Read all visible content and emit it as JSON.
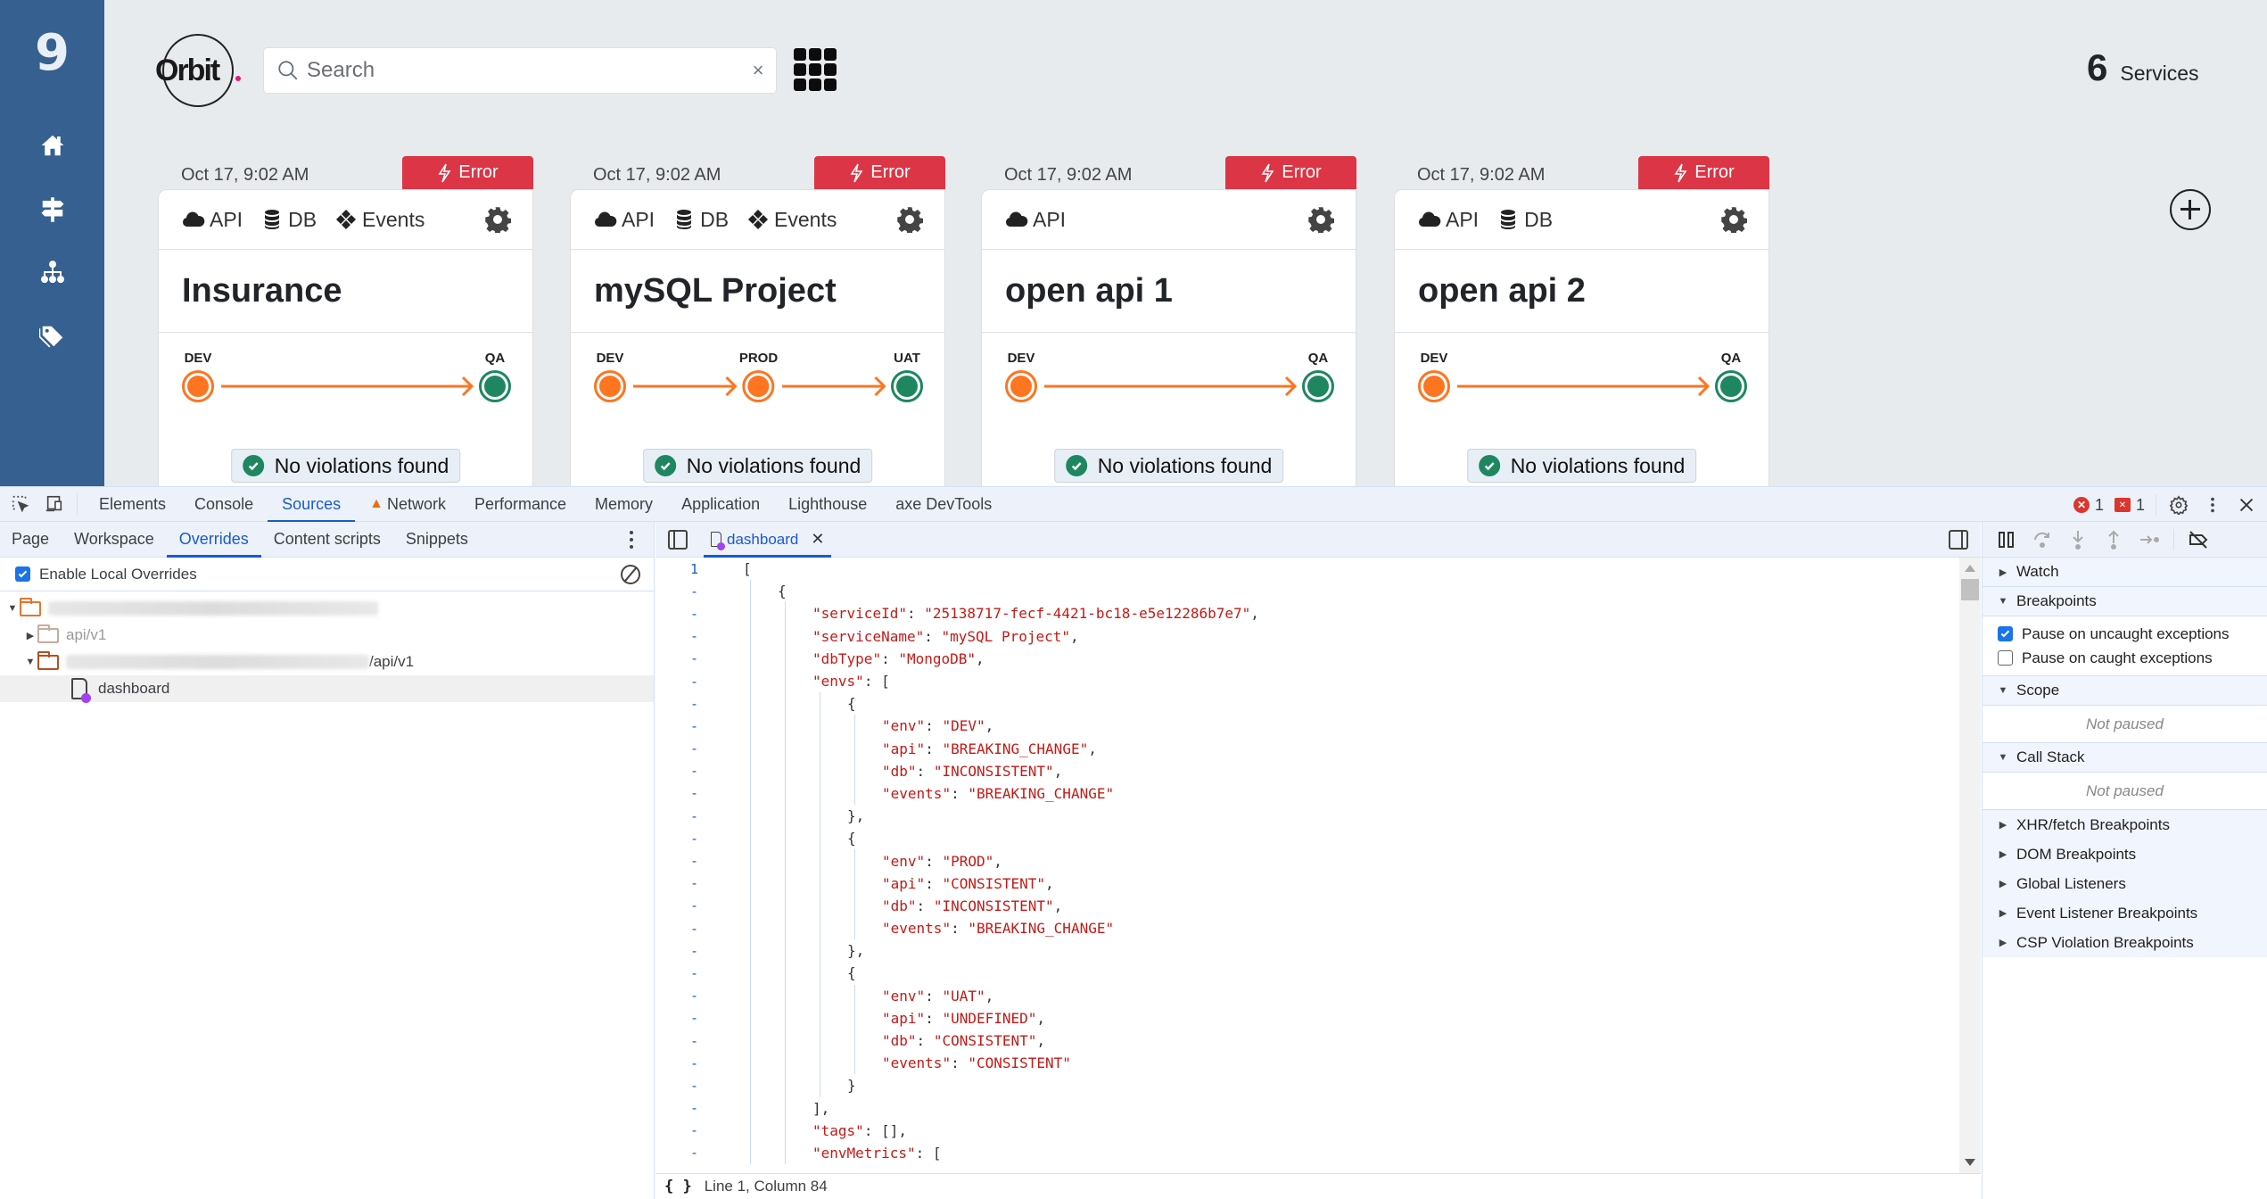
{
  "app": {
    "sidebar": {
      "logo": "9",
      "items": [
        {
          "name": "home",
          "icon": "home-icon"
        },
        {
          "name": "signpost",
          "icon": "signpost-icon"
        },
        {
          "name": "sitemap",
          "icon": "sitemap-icon"
        },
        {
          "name": "tags",
          "icon": "tags-icon"
        }
      ]
    },
    "brand": "Orbit",
    "search": {
      "placeholder": "Search",
      "value": "",
      "clear_label": "×"
    },
    "services_count": {
      "number": "6",
      "label": "Services"
    },
    "colors": {
      "sidebar": "#35608f",
      "error": "#dc3545",
      "env_warning": "#fd7521",
      "env_ok": "#1e8760",
      "badge_bg": "#e7eef6"
    },
    "cards": [
      {
        "date": "Oct 17, 9:02 AM",
        "status": "Error",
        "features": [
          {
            "label": "API",
            "icon": "cloud-icon"
          },
          {
            "label": "DB",
            "icon": "database-icon"
          },
          {
            "label": "Events",
            "icon": "events-icon"
          }
        ],
        "title": "Insurance",
        "envs": [
          {
            "name": "DEV",
            "state": "orange"
          },
          {
            "name": "QA",
            "state": "green"
          }
        ],
        "violations": "No violations found"
      },
      {
        "date": "Oct 17, 9:02 AM",
        "status": "Error",
        "features": [
          {
            "label": "API",
            "icon": "cloud-icon"
          },
          {
            "label": "DB",
            "icon": "database-icon"
          },
          {
            "label": "Events",
            "icon": "events-icon"
          }
        ],
        "title": "mySQL Project",
        "envs": [
          {
            "name": "DEV",
            "state": "orange"
          },
          {
            "name": "PROD",
            "state": "orange"
          },
          {
            "name": "UAT",
            "state": "green"
          }
        ],
        "violations": "No violations found"
      },
      {
        "date": "Oct 17, 9:02 AM",
        "status": "Error",
        "features": [
          {
            "label": "API",
            "icon": "cloud-icon"
          }
        ],
        "title": "open api 1",
        "envs": [
          {
            "name": "DEV",
            "state": "orange"
          },
          {
            "name": "QA",
            "state": "green"
          }
        ],
        "violations": "No violations found"
      },
      {
        "date": "Oct 17, 9:02 AM",
        "status": "Error",
        "features": [
          {
            "label": "API",
            "icon": "cloud-icon"
          },
          {
            "label": "DB",
            "icon": "database-icon"
          }
        ],
        "title": "open api 2",
        "envs": [
          {
            "name": "DEV",
            "state": "orange"
          },
          {
            "name": "QA",
            "state": "green"
          }
        ],
        "violations": "No violations found"
      }
    ]
  },
  "devtools": {
    "tabs": [
      {
        "label": "Elements"
      },
      {
        "label": "Console"
      },
      {
        "label": "Sources",
        "active": true
      },
      {
        "label": "Network",
        "warning": true
      },
      {
        "label": "Performance"
      },
      {
        "label": "Memory"
      },
      {
        "label": "Application"
      },
      {
        "label": "Lighthouse"
      },
      {
        "label": "axe DevTools"
      }
    ],
    "error_count": "1",
    "issue_count": "1",
    "navigator": {
      "tabs": [
        {
          "label": "Page"
        },
        {
          "label": "Workspace"
        },
        {
          "label": "Overrides",
          "active": true
        },
        {
          "label": "Content scripts"
        },
        {
          "label": "Snippets"
        }
      ],
      "enable_overrides_label": "Enable Local Overrides",
      "enable_overrides_checked": true,
      "tree": [
        {
          "level": 0,
          "expanded": true,
          "type": "folder",
          "label": "",
          "blurred": true,
          "color": "#e8742e"
        },
        {
          "level": 1,
          "expanded": false,
          "type": "folder",
          "label": "api/v1",
          "blurred": false,
          "color": "#c5aca0",
          "muted": true
        },
        {
          "level": 1,
          "expanded": true,
          "type": "folder",
          "label": "/api/v1",
          "blurred": true,
          "color": "#b8501f"
        },
        {
          "level": 2,
          "type": "file",
          "label": "dashboard",
          "selected": true
        }
      ]
    },
    "editor": {
      "open_file": "dashboard",
      "first_line_number": "1",
      "other_line_marker": "-",
      "lines": [
        {
          "indent": 0,
          "text": "["
        },
        {
          "indent": 1,
          "text": "{"
        },
        {
          "indent": 2,
          "key": "serviceId",
          "value": "\"25138717-fecf-4421-bc18-e5e12286b7e7\"",
          "trail": ","
        },
        {
          "indent": 2,
          "key": "serviceName",
          "value": "\"mySQL Project\"",
          "trail": ","
        },
        {
          "indent": 2,
          "key": "dbType",
          "value": "\"MongoDB\"",
          "trail": ","
        },
        {
          "indent": 2,
          "key": "envs",
          "value": "[",
          "raw": true
        },
        {
          "indent": 3,
          "text": "{"
        },
        {
          "indent": 4,
          "key": "env",
          "value": "\"DEV\"",
          "trail": ","
        },
        {
          "indent": 4,
          "key": "api",
          "value": "\"BREAKING_CHANGE\"",
          "trail": ","
        },
        {
          "indent": 4,
          "key": "db",
          "value": "\"INCONSISTENT\"",
          "trail": ","
        },
        {
          "indent": 4,
          "key": "events",
          "value": "\"BREAKING_CHANGE\"",
          "trail": ""
        },
        {
          "indent": 3,
          "text": "},"
        },
        {
          "indent": 3,
          "text": "{"
        },
        {
          "indent": 4,
          "key": "env",
          "value": "\"PROD\"",
          "trail": ","
        },
        {
          "indent": 4,
          "key": "api",
          "value": "\"CONSISTENT\"",
          "trail": ","
        },
        {
          "indent": 4,
          "key": "db",
          "value": "\"INCONSISTENT\"",
          "trail": ","
        },
        {
          "indent": 4,
          "key": "events",
          "value": "\"BREAKING_CHANGE\"",
          "trail": ""
        },
        {
          "indent": 3,
          "text": "},"
        },
        {
          "indent": 3,
          "text": "{"
        },
        {
          "indent": 4,
          "key": "env",
          "value": "\"UAT\"",
          "trail": ","
        },
        {
          "indent": 4,
          "key": "api",
          "value": "\"UNDEFINED\"",
          "trail": ","
        },
        {
          "indent": 4,
          "key": "db",
          "value": "\"CONSISTENT\"",
          "trail": ","
        },
        {
          "indent": 4,
          "key": "events",
          "value": "\"CONSISTENT\"",
          "trail": ""
        },
        {
          "indent": 3,
          "text": "}"
        },
        {
          "indent": 2,
          "text": "],"
        },
        {
          "indent": 2,
          "key": "tags",
          "value": "[]",
          "raw": true,
          "trail": ","
        },
        {
          "indent": 2,
          "key": "envMetrics",
          "value": "[",
          "raw": true
        }
      ],
      "status": "Line 1, Column 84"
    },
    "debugger": {
      "sections": [
        {
          "label": "Watch",
          "expanded": false
        },
        {
          "label": "Breakpoints",
          "expanded": true,
          "options": [
            {
              "label": "Pause on uncaught exceptions",
              "checked": true
            },
            {
              "label": "Pause on caught exceptions",
              "checked": false
            }
          ]
        },
        {
          "label": "Scope",
          "expanded": true,
          "empty": "Not paused"
        },
        {
          "label": "Call Stack",
          "expanded": true,
          "empty": "Not paused"
        },
        {
          "label": "XHR/fetch Breakpoints",
          "expanded": false
        },
        {
          "label": "DOM Breakpoints",
          "expanded": false
        },
        {
          "label": "Global Listeners",
          "expanded": false
        },
        {
          "label": "Event Listener Breakpoints",
          "expanded": false
        },
        {
          "label": "CSP Violation Breakpoints",
          "expanded": false
        }
      ]
    }
  }
}
